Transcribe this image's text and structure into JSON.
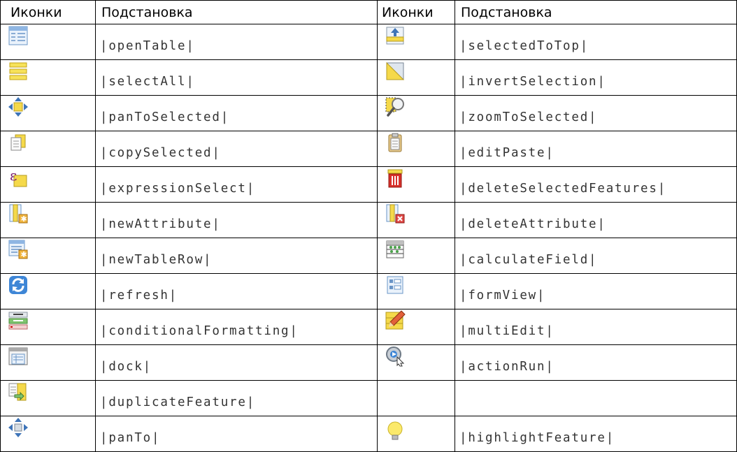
{
  "header": {
    "icons_1": "Иконки",
    "sub_1": "Подстановка",
    "icons_2": "Иконки",
    "sub_2": "Подстановка"
  },
  "rows": [
    {
      "left_icon": "open-table-icon",
      "left": "|openTable|",
      "right_icon": "selected-to-top-icon",
      "right": "|selectedToTop|"
    },
    {
      "left_icon": "select-all-icon",
      "left": "|selectAll|",
      "right_icon": "invert-selection-icon",
      "right": "|invertSelection|"
    },
    {
      "left_icon": "pan-to-selected-icon",
      "left": "|panToSelected|",
      "right_icon": "zoom-to-selected-icon",
      "right": "|zoomToSelected|"
    },
    {
      "left_icon": "copy-selected-icon",
      "left": "|copySelected|",
      "right_icon": "edit-paste-icon",
      "right": "|editPaste|"
    },
    {
      "left_icon": "expression-select-icon",
      "left": "|expressionSelect|",
      "right_icon": "delete-selected-features-icon",
      "right": "|deleteSelectedFeatures|"
    },
    {
      "left_icon": "new-attribute-icon",
      "left": "|newAttribute|",
      "right_icon": "delete-attribute-icon",
      "right": "|deleteAttribute|"
    },
    {
      "left_icon": "new-table-row-icon",
      "left": "|newTableRow|",
      "right_icon": "calculate-field-icon",
      "right": "|calculateField|"
    },
    {
      "left_icon": "refresh-icon",
      "left": "|refresh|",
      "right_icon": "form-view-icon",
      "right": "|formView|"
    },
    {
      "left_icon": "conditional-formatting-icon",
      "left": "|conditionalFormatting|",
      "right_icon": "multi-edit-icon",
      "right": "|multiEdit|"
    },
    {
      "left_icon": "dock-icon",
      "left": "|dock|",
      "right_icon": "action-run-icon",
      "right": "|actionRun|"
    },
    {
      "left_icon": "duplicate-feature-icon",
      "left": "|duplicateFeature|",
      "right_icon": "",
      "right": ""
    },
    {
      "left_icon": "pan-to-icon",
      "left": "|panTo|",
      "right_icon": "highlight-feature-icon",
      "right": "|highlightFeature|"
    }
  ]
}
